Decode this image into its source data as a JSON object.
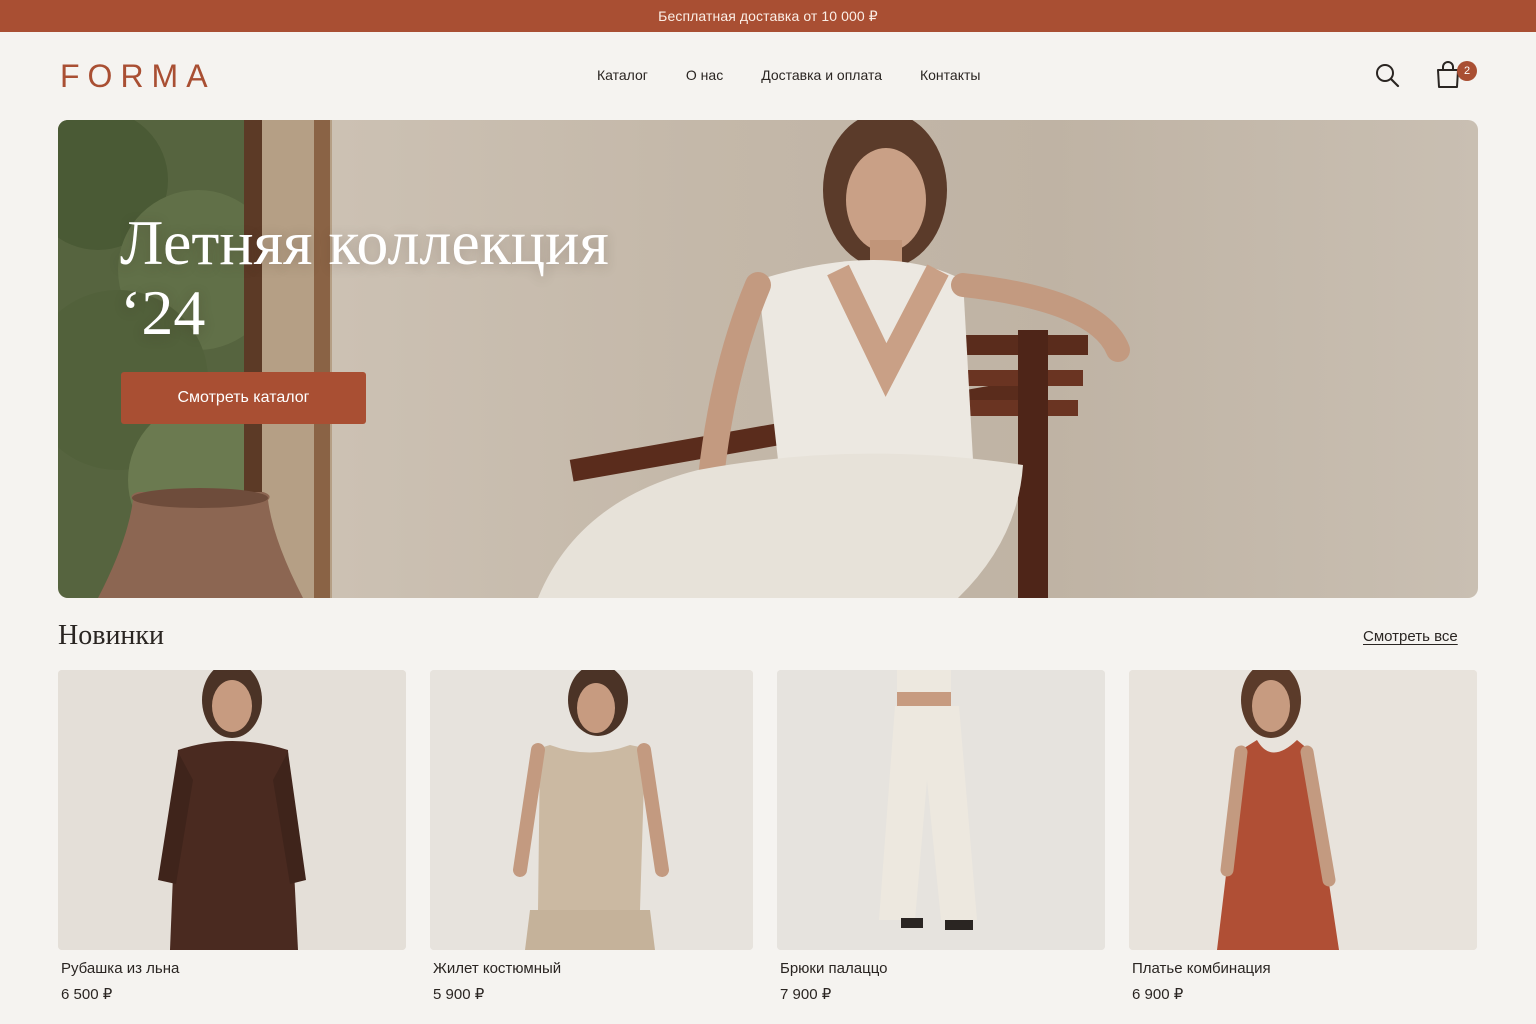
{
  "promo": {
    "text": "Бесплатная доставка от 10 000 ₽"
  },
  "header": {
    "logo": "FORMA",
    "nav": [
      "Каталог",
      "О нас",
      "Доставка и оплата",
      "Контакты"
    ],
    "cart_count": "2"
  },
  "hero": {
    "title_line1": "Летняя коллекция",
    "title_line2": "‘24",
    "cta": "Смотреть каталог"
  },
  "new_arrivals": {
    "title": "Новинки",
    "see_all": "Смотреть все",
    "products": [
      {
        "name": "Рубашка из льна",
        "price": "6 500 ₽",
        "color": "#4a2a20"
      },
      {
        "name": "Жилет костюмный",
        "price": "5 900 ₽",
        "color": "#cbb9a2"
      },
      {
        "name": "Брюки палаццо",
        "price": "7 900 ₽",
        "color": "#ede8df"
      },
      {
        "name": "Платье комбинация",
        "price": "6 900 ₽",
        "color": "#b04f35"
      }
    ]
  },
  "colors": {
    "accent": "#a94f33",
    "background": "#f5f3f0"
  }
}
